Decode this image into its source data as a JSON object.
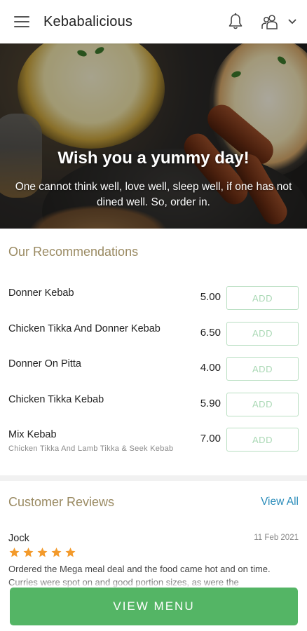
{
  "header": {
    "title": "Kebabalicious",
    "icons": [
      "hamburger-menu-icon",
      "bell-icon",
      "user-group-icon",
      "chevron-down-icon"
    ]
  },
  "hero": {
    "title": "Wish you a yummy day!",
    "subtitle": "One cannot think well, love well, sleep well, if one has not dined well. So, order in."
  },
  "recommendations": {
    "title": "Our Recommendations",
    "items": [
      {
        "name": "Donner Kebab",
        "description": "",
        "price": "5.00",
        "button": "ADD"
      },
      {
        "name": "Chicken Tikka And Donner Kebab",
        "description": "",
        "price": "6.50",
        "button": "ADD"
      },
      {
        "name": "Donner On Pitta",
        "description": "",
        "price": "4.00",
        "button": "ADD"
      },
      {
        "name": "Chicken Tikka Kebab",
        "description": "",
        "price": "5.90",
        "button": "ADD"
      },
      {
        "name": "Mix Kebab",
        "description": "Chicken Tikka And Lamb Tikka & Seek Kebab",
        "price": "7.00",
        "button": "ADD"
      }
    ]
  },
  "reviews": {
    "title": "Customer Reviews",
    "view_all": "View All",
    "items": [
      {
        "author": "Jock",
        "date": "11 Feb 2021",
        "rating": 5,
        "text": "Ordered the Mega meal deal and the food came hot and on time. Curries were spot on and good portion sizes, as were the"
      }
    ]
  },
  "footer": {
    "button": "VIEW MENU"
  },
  "colors": {
    "accent_green": "#54b565",
    "add_border": "#b9dfc2",
    "section_title": "#9a8a62",
    "link_blue": "#2a8cba",
    "star_orange": "#f39a2b"
  }
}
